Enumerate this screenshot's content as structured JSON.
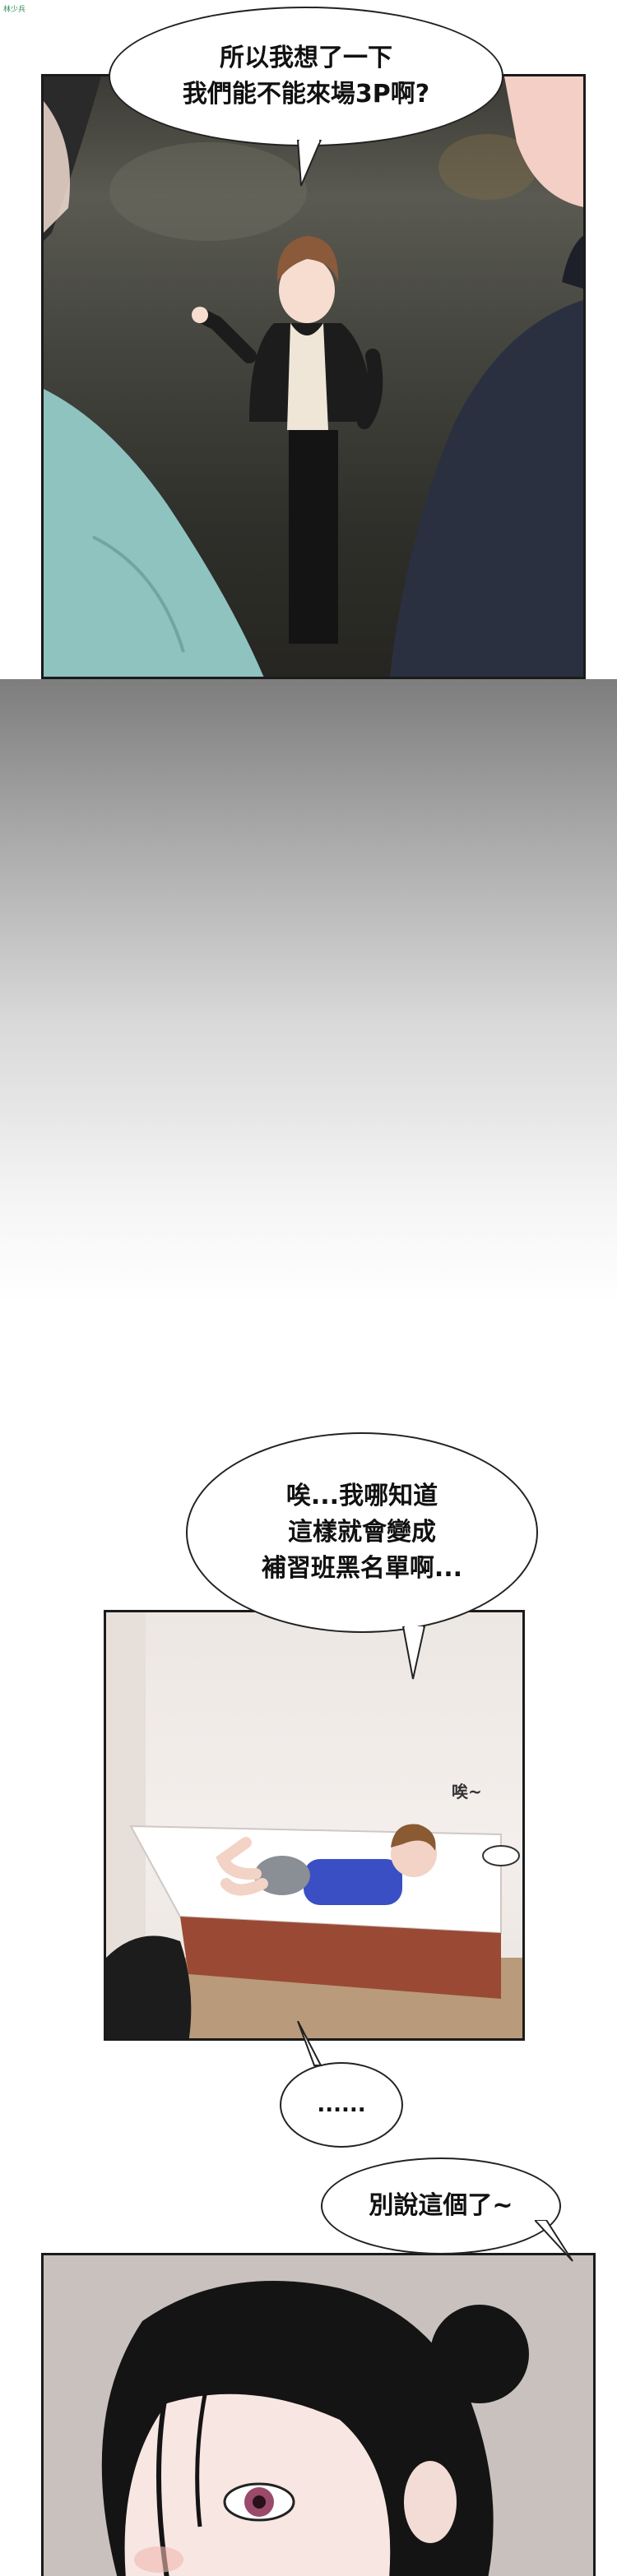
{
  "watermark": "林少兵",
  "panels": [
    {
      "id": "panel1",
      "bubble": "所以我想了一下\n我們能不能來場3P啊?"
    },
    {
      "id": "panel2",
      "bubble_main": "唉...我哪知道\n這樣就會變成\n補習班黑名單啊...",
      "bubble_small": "......",
      "sfx": "唉~"
    },
    {
      "id": "panel3",
      "bubble": "別說這個了~"
    }
  ],
  "colors": {
    "panel_border": "#1b1b1b",
    "bubble_fill": "#ffffff",
    "bubble_stroke": "#222222",
    "teal_shirt": "#8ec3c0",
    "navy_jacket": "#2b3040",
    "blue_shirt": "#3a4fc4",
    "bed_frame": "#9a4a34"
  }
}
